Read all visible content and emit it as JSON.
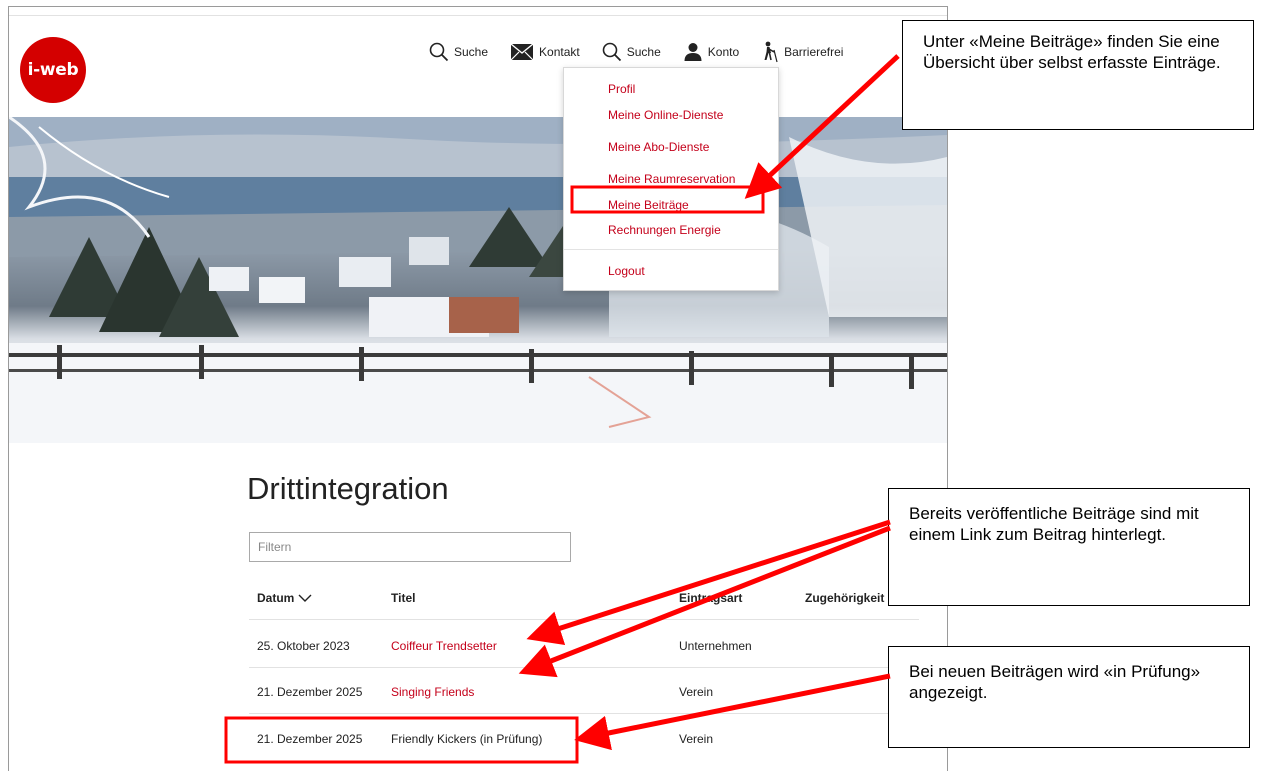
{
  "logo": {
    "text": "i-web"
  },
  "nav": {
    "items": [
      {
        "label": "Suche",
        "icon": "search-icon"
      },
      {
        "label": "Kontakt",
        "icon": "envelope-icon"
      },
      {
        "label": "Suche",
        "icon": "search-icon"
      },
      {
        "label": "Konto",
        "icon": "user-icon"
      },
      {
        "label": "Barrierefrei",
        "icon": "accessibility-icon"
      }
    ]
  },
  "dropdown": {
    "items": [
      "Profil",
      "Meine Online-Dienste",
      "Meine Abo-Dienste",
      "Meine Raumreservation",
      "Meine Beiträge",
      "Rechnungen Energie",
      "Logout"
    ]
  },
  "page": {
    "title": "Drittintegration",
    "filter_placeholder": "Filtern"
  },
  "table": {
    "headers": {
      "date": "Datum",
      "title": "Titel",
      "type": "Eintragsart",
      "belonging": "Zugehörigkeit"
    },
    "rows": [
      {
        "date": "25. Oktober 2023",
        "title": "Coiffeur Trendsetter",
        "type": "Unternehmen",
        "is_link": true
      },
      {
        "date": "21. Dezember 2025",
        "title": "Singing Friends",
        "type": "Verein",
        "is_link": true
      },
      {
        "date": "21. Dezember 2025",
        "title": "Friendly Kickers (in Prüfung)",
        "type": "Verein",
        "is_link": false
      }
    ]
  },
  "callouts": {
    "menu": "Unter «Meine Beiträge» finden Sie eine Übersicht über selbst erfasste Einträge.",
    "published": "Bereits veröffentliche Beiträge sind mit einem Link zum Beitrag hinterlegt.",
    "review": "Bei neuen Beiträgen wird «in Prüfung» angezeigt."
  },
  "colors": {
    "brand": "#d40000",
    "link": "#c4001a",
    "annotation": "#ff0000"
  }
}
